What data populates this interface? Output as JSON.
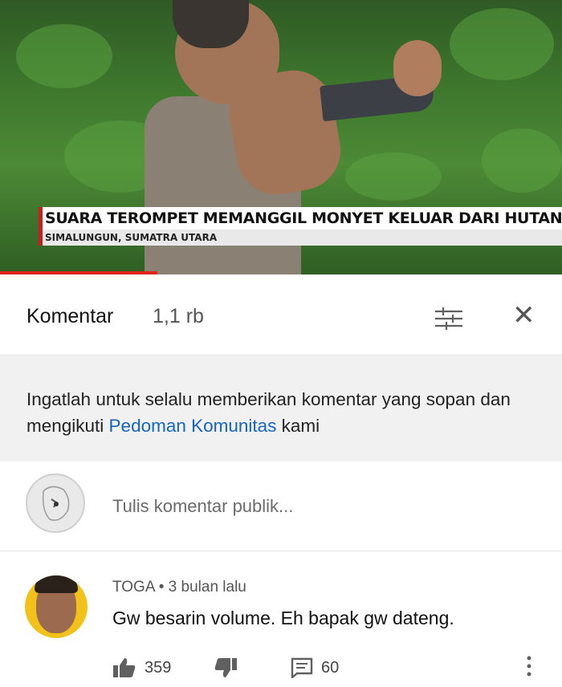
{
  "video": {
    "headline": "SUARA TEROMPET MEMANGGIL MONYET KELUAR DARI HUTAN",
    "location": "SIMALUNGUN, SUMATRA UTARA"
  },
  "comments_header": {
    "title": "Komentar",
    "count": "1,1 rb",
    "filter_icon": "sort-filter-icon",
    "close_icon": "close-icon"
  },
  "notice": {
    "text_before": "Ingatlah untuk selalu memberikan komentar yang sopan dan mengikuti ",
    "link": "Pedoman Komunitas",
    "text_after": " kami"
  },
  "compose": {
    "placeholder": "Tulis komentar publik..."
  },
  "comment": {
    "author": "TOGA",
    "separator": "•",
    "time": "3 bulan lalu",
    "text": "Gw besarin volume. Eh bapak gw dateng.",
    "likes": "359",
    "replies": "60"
  },
  "colors": {
    "accent_red": "#e0241c",
    "link_blue": "#1565c0"
  }
}
